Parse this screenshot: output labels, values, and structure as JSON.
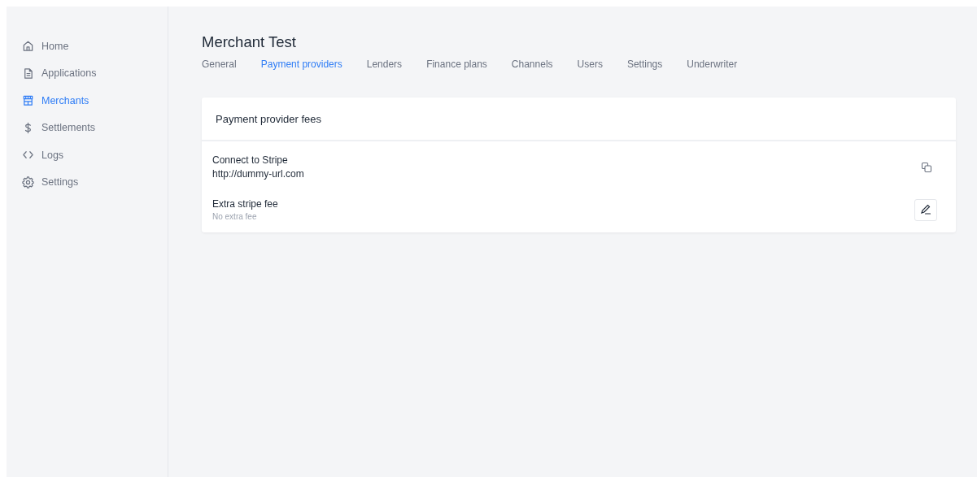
{
  "sidebar": {
    "items": [
      {
        "label": "Home",
        "selected": false
      },
      {
        "label": "Applications",
        "selected": false
      },
      {
        "label": "Merchants",
        "selected": true
      },
      {
        "label": "Settlements",
        "selected": false
      },
      {
        "label": "Logs",
        "selected": false
      },
      {
        "label": "Settings",
        "selected": false
      }
    ]
  },
  "page": {
    "title": "Merchant Test",
    "tabs": [
      {
        "label": "General",
        "selected": false
      },
      {
        "label": "Payment providers",
        "selected": true
      },
      {
        "label": "Lenders",
        "selected": false
      },
      {
        "label": "Finance plans",
        "selected": false
      },
      {
        "label": "Channels",
        "selected": false
      },
      {
        "label": "Users",
        "selected": false
      },
      {
        "label": "Settings",
        "selected": false
      },
      {
        "label": "Underwriter",
        "selected": false
      }
    ]
  },
  "card": {
    "title": "Payment provider fees",
    "rows": [
      {
        "kind": "link",
        "label": "Connect to Stripe",
        "value": "http://dummy-url.com"
      },
      {
        "kind": "fee",
        "label": "Extra stripe fee",
        "value": "No extra fee"
      }
    ]
  }
}
